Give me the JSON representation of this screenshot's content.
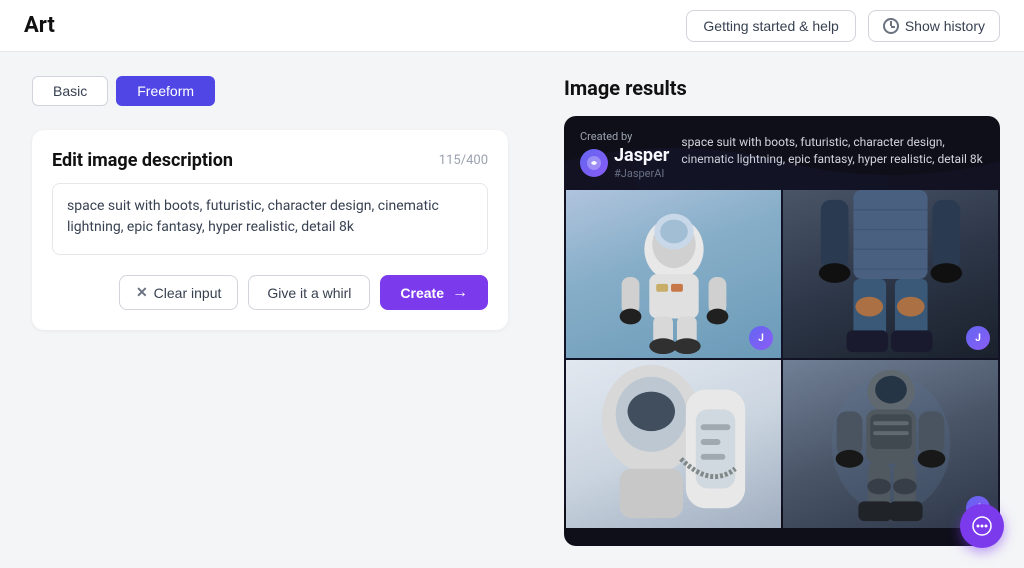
{
  "topbar": {
    "title": "Art",
    "help_button": "Getting started & help",
    "history_button": "Show history"
  },
  "tabs": {
    "basic": "Basic",
    "freeform": "Freeform"
  },
  "edit": {
    "title": "Edit image description",
    "char_count": "115/400",
    "textarea_value": "space suit with boots, futuristic, character design, cinematic lightning, epic fantasy, hyper realistic, detail 8k",
    "clear_button": "Clear input",
    "whirl_button": "Give it a whirl",
    "create_button": "Create"
  },
  "results": {
    "title": "Image results",
    "card": {
      "created_by": "Created by",
      "brand": "Jasper",
      "handle": "#JasperAI",
      "prompt": "space suit with boots, futuristic, character design, cinematic lightning, epic fantasy, hyper realistic, detail 8k"
    }
  },
  "fab": {
    "label": "chat"
  }
}
